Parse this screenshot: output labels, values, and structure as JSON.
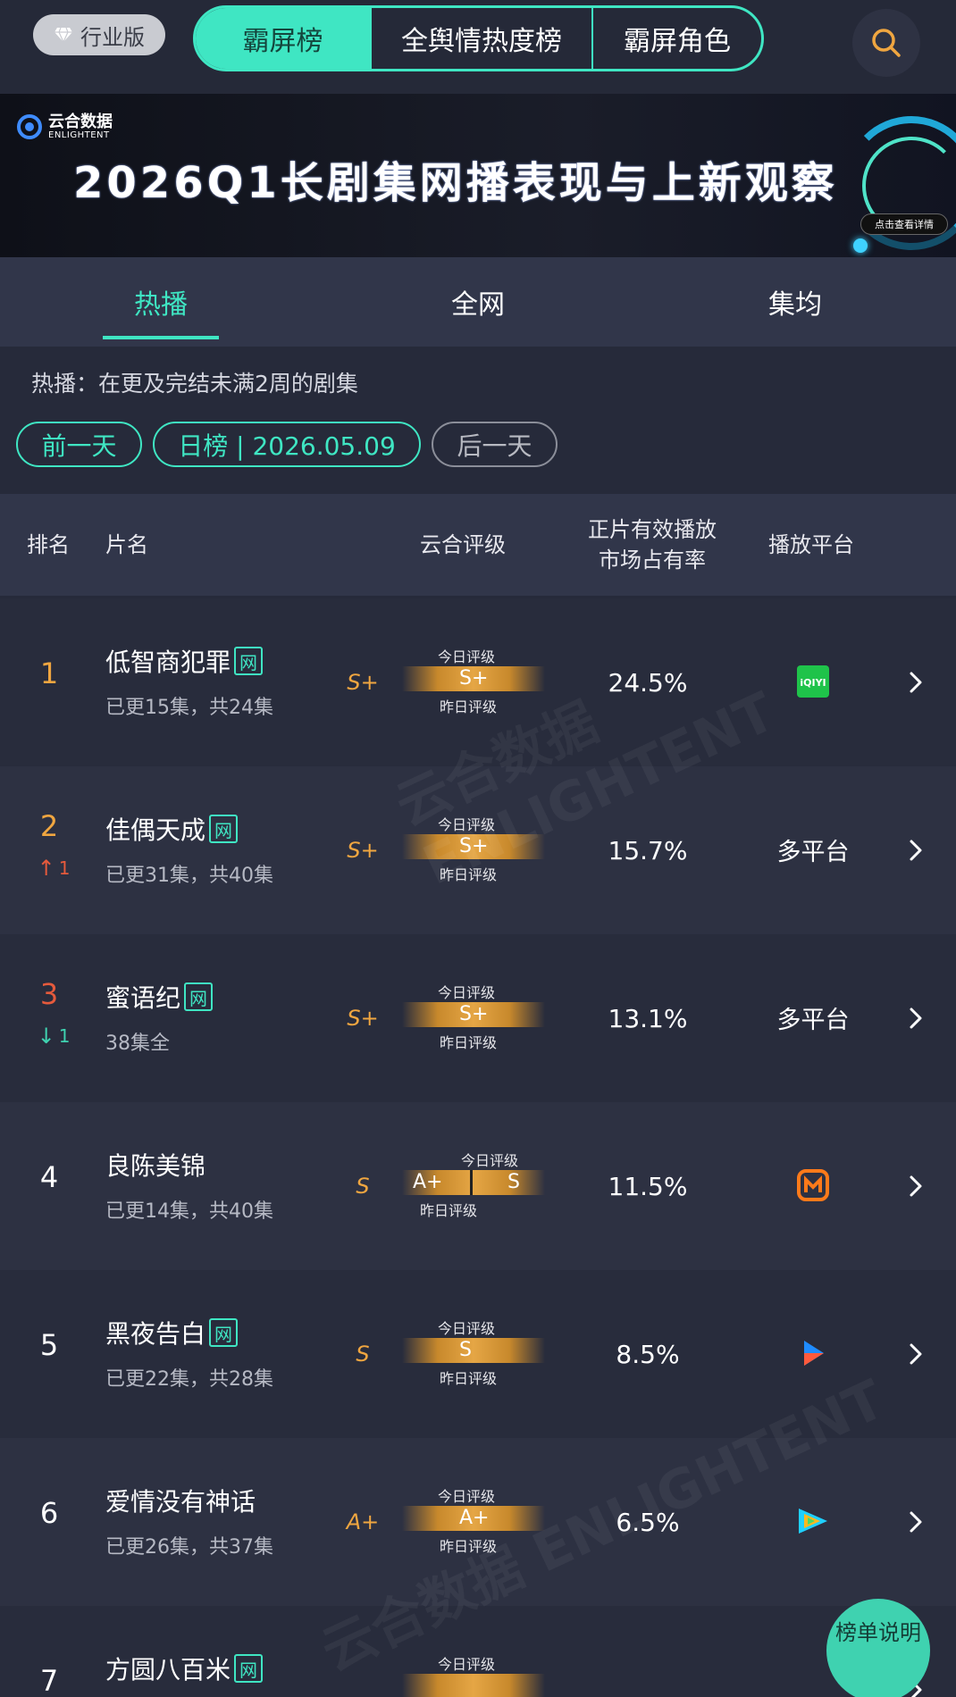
{
  "top_nav": {
    "edition_label": "行业版",
    "tabs": [
      "霸屏榜",
      "全舆情热度榜",
      "霸屏角色"
    ],
    "active_tab": "霸屏榜",
    "accent_color": "#3fe6c3"
  },
  "banner": {
    "logo_cn": "云合数据",
    "logo_en": "ENLIGHTENT",
    "title": "2026Q1长剧集网播表现与上新观察",
    "detail_button": "点击查看详情"
  },
  "sub_tabs": {
    "items": [
      "热播",
      "全网",
      "集均"
    ],
    "active": "热播"
  },
  "description": "热播：在更及完结未满2周的剧集",
  "date_nav": {
    "prev_label": "前一天",
    "current_label": "日榜 | 2026.05.09",
    "next_label": "后一天"
  },
  "table": {
    "headers": {
      "rank": "排名",
      "title": "片名",
      "grade": "云合评级",
      "share": "正片有效播放\n市场占有率",
      "platform": "播放平台"
    },
    "today_label": "今日评级",
    "yesterday_label": "昨日评级",
    "rows": [
      {
        "rank": "1",
        "change_dir": "",
        "change": "",
        "title": "低智商犯罪",
        "net_badge": "网",
        "episodes": "已更15集，共24集",
        "grade": "S+",
        "bar_text": "S+",
        "bar_text2": "",
        "share": "24.5%",
        "platform": "iqiyi-icon"
      },
      {
        "rank": "2",
        "change_dir": "up",
        "change": "1",
        "title": "佳偶天成",
        "net_badge": "网",
        "episodes": "已更31集，共40集",
        "grade": "S+",
        "bar_text": "S+",
        "bar_text2": "",
        "share": "15.7%",
        "platform": "多平台"
      },
      {
        "rank": "3",
        "change_dir": "down",
        "change": "1",
        "title": "蜜语纪",
        "net_badge": "网",
        "episodes": "38集全",
        "grade": "S+",
        "bar_text": "S+",
        "bar_text2": "",
        "share": "13.1%",
        "platform": "多平台"
      },
      {
        "rank": "4",
        "change_dir": "",
        "change": "",
        "title": "良陈美锦",
        "net_badge": "",
        "episodes": "已更14集，共40集",
        "grade": "S",
        "bar_text": "A+",
        "bar_text2": "S",
        "share": "11.5%",
        "platform": "mango-icon"
      },
      {
        "rank": "5",
        "change_dir": "",
        "change": "",
        "title": "黑夜告白",
        "net_badge": "网",
        "episodes": "已更22集，共28集",
        "grade": "S",
        "bar_text": "S",
        "bar_text2": "",
        "share": "8.5%",
        "platform": "youku-icon"
      },
      {
        "rank": "6",
        "change_dir": "",
        "change": "",
        "title": "爱情没有神话",
        "net_badge": "",
        "episodes": "已更26集，共37集",
        "grade": "A+",
        "bar_text": "A+",
        "bar_text2": "",
        "share": "6.5%",
        "platform": "tencent-video-icon"
      },
      {
        "rank": "7",
        "change_dir": "",
        "change": "",
        "title": "方圆八百米",
        "net_badge": "网",
        "episodes": "",
        "grade": "",
        "bar_text": "",
        "bar_text2": "",
        "share": "",
        "platform": ""
      }
    ]
  },
  "float_button": "榜单说明",
  "watermark": "云合数据 ENLIGHTENT"
}
